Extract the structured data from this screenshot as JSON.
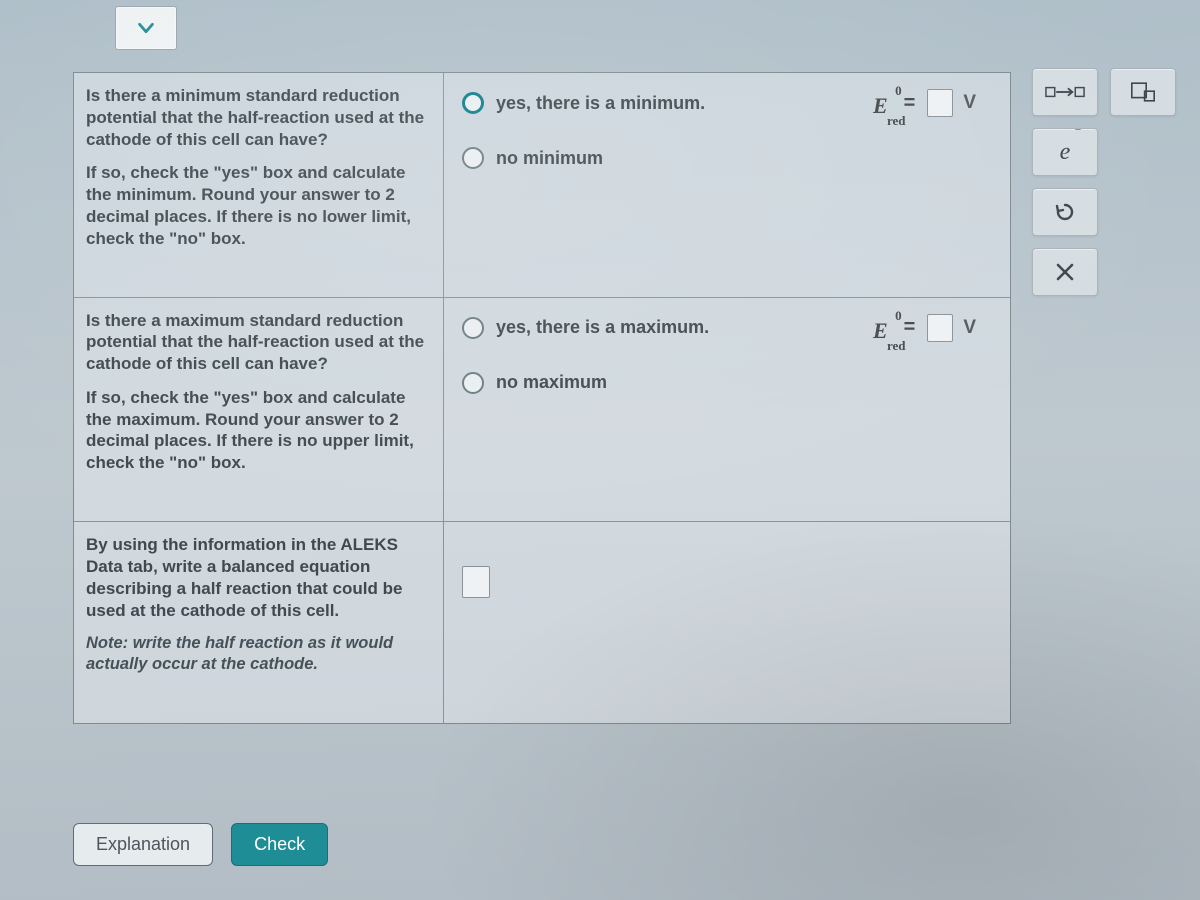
{
  "rows": [
    {
      "question_main": "Is there a minimum standard reduction potential that the half-reaction used at the cathode of this cell can have?",
      "question_sub": "If so, check the \"yes\" box and calculate the minimum. Round your answer to 2 decimal places. If there is no lower limit, check the \"no\" box.",
      "yes_label": "yes, there is a minimum.",
      "no_label": "no minimum",
      "E_symbol": "E",
      "E_sup": "0",
      "E_sub": "red",
      "equals": "=",
      "unit": "V",
      "yes_selected": true
    },
    {
      "question_main": "Is there a maximum standard reduction potential that the half-reaction used at the cathode of this cell can have?",
      "question_sub": "If so, check the \"yes\" box and calculate the maximum. Round your answer to 2 decimal places. If there is no upper limit, check the \"no\" box.",
      "yes_label": "yes, there is a maximum.",
      "no_label": "no maximum",
      "E_symbol": "E",
      "E_sup": "0",
      "E_sub": "red",
      "equals": "=",
      "unit": "V",
      "yes_selected": false
    },
    {
      "question_main": "By using the information in the ALEKS Data tab, write a balanced equation describing a half reaction that could be used at the cathode of this cell.",
      "question_note": "Note: write the half reaction as it would actually occur at the cathode."
    }
  ],
  "footer": {
    "explanation": "Explanation",
    "check": "Check"
  },
  "palette": {
    "electron": "e",
    "reset_title": "reset",
    "arrow_title": "yields",
    "stacked_title": "stacked",
    "close_title": "close"
  }
}
